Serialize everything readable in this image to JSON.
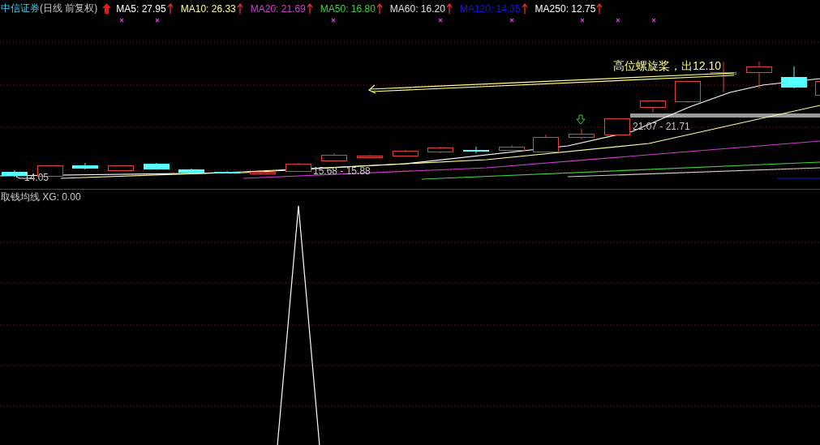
{
  "header": {
    "stock": "中信证券",
    "period": "(日线 前复权)",
    "trend_up": true,
    "indicators": [
      {
        "label": "MA5: 27.95",
        "color": "#ffffff",
        "rising": true
      },
      {
        "label": "MA10: 26.33",
        "color": "#ffff99",
        "rising": true
      },
      {
        "label": "MA20: 21.69",
        "color": "#d040d0",
        "rising": true
      },
      {
        "label": "MA50: 16.80",
        "color": "#40d040",
        "rising": true
      },
      {
        "label": "MA60: 16.20",
        "color": "#e0e0e0",
        "rising": true
      },
      {
        "label": "MA120: 14.35",
        "color": "#1a1ad0",
        "rising": true
      },
      {
        "label": "MA250: 12.75",
        "color": "#ffffff",
        "rising": true
      }
    ]
  },
  "price_panel": {
    "annotation": "高位螺旋桨，出12.10",
    "range_labels": [
      "21.07 - 21.71",
      "15.68 - 15.88"
    ],
    "low_label": "14.05"
  },
  "indicator_panel": {
    "title": "取钱均线 XG: 0.00"
  }
}
